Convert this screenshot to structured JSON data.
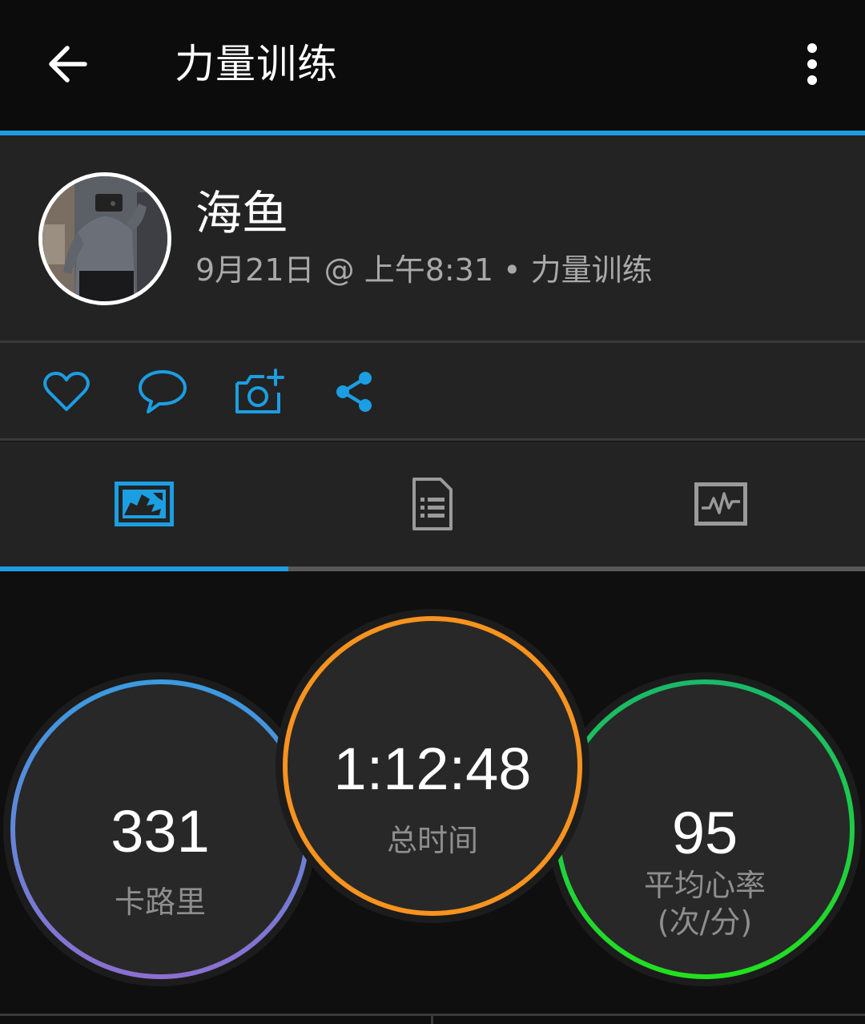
{
  "header": {
    "title": "力量训练",
    "back_icon": "arrow-left-icon",
    "more_icon": "more-vertical-icon"
  },
  "profile": {
    "name": "海鱼",
    "meta": "9月21日 @ 上午8:31 • 力量训练"
  },
  "actions": [
    {
      "icon": "heart-icon"
    },
    {
      "icon": "comment-icon"
    },
    {
      "icon": "add-photo-icon"
    },
    {
      "icon": "share-icon"
    }
  ],
  "tabs": [
    {
      "icon": "map-overview-icon",
      "selected": true
    },
    {
      "icon": "details-document-icon",
      "selected": false
    },
    {
      "icon": "chart-activity-icon",
      "selected": false
    }
  ],
  "stats": {
    "calories": {
      "value": "331",
      "label": "卡路里"
    },
    "total_time": {
      "value": "1:12:48",
      "label": "总时间"
    },
    "avg_hr": {
      "value": "95",
      "label_line1": "平均心率",
      "label_line2": "(次/分)"
    }
  },
  "colors": {
    "accent": "#1b9ee2",
    "calories_ring_start": "#3a9be0",
    "calories_ring_end": "#8b6fd0",
    "time_ring": "#f7931e",
    "hr_ring_start": "#1ab86a",
    "hr_ring_end": "#22e01f"
  }
}
